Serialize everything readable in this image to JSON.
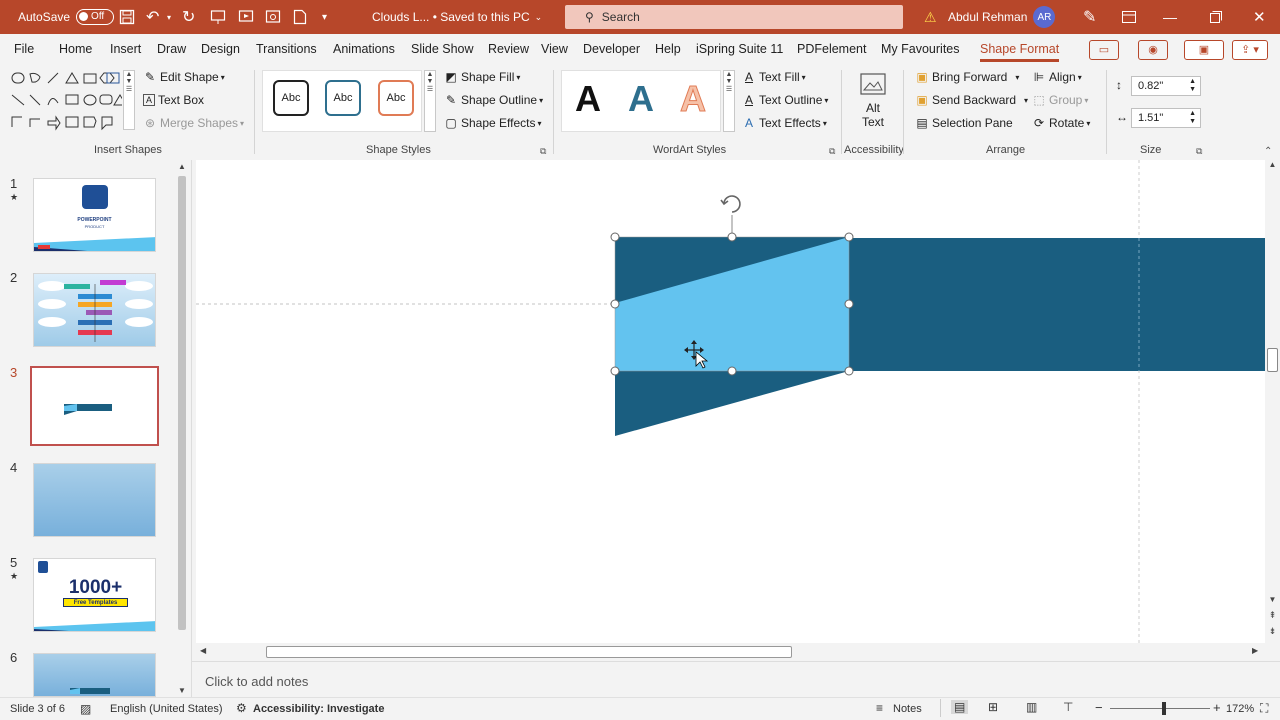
{
  "titlebar": {
    "autosave_label": "AutoSave",
    "autosave_state": "Off",
    "doc_title": "Clouds L... • Saved to this PC",
    "search_placeholder": "Search",
    "user_name": "Abdul Rehman",
    "user_initials": "AR",
    "accent": "#b7472a"
  },
  "tabs": [
    "File",
    "Home",
    "Insert",
    "Draw",
    "Design",
    "Transitions",
    "Animations",
    "Slide Show",
    "Review",
    "View",
    "Developer",
    "Help",
    "iSpring Suite 11",
    "PDFelement",
    "My Favourites",
    "Shape Format"
  ],
  "active_tab": "Shape Format",
  "ribbon": {
    "insert_shapes": {
      "label": "Insert Shapes",
      "edit_shape": "Edit Shape",
      "text_box": "Text Box",
      "merge_shapes": "Merge Shapes"
    },
    "shape_styles": {
      "label": "Shape Styles",
      "abc": "Abc",
      "shape_fill": "Shape Fill",
      "shape_outline": "Shape Outline",
      "shape_effects": "Shape Effects"
    },
    "wordart_styles": {
      "label": "WordArt Styles",
      "letter": "A",
      "text_fill": "Text Fill",
      "text_outline": "Text Outline",
      "text_effects": "Text Effects"
    },
    "accessibility": {
      "label": "Accessibility",
      "alt_text_1": "Alt",
      "alt_text_2": "Text"
    },
    "arrange": {
      "label": "Arrange",
      "bring_forward": "Bring Forward",
      "send_backward": "Send Backward",
      "selection_pane": "Selection Pane",
      "align": "Align",
      "group": "Group",
      "rotate": "Rotate"
    },
    "size": {
      "label": "Size",
      "height": "0.82\"",
      "width": "1.51\""
    }
  },
  "slides": [
    {
      "num": "1",
      "star": "★",
      "text1": "POWERPOINT",
      "text2": "PRODUCT"
    },
    {
      "num": "2",
      "star": ""
    },
    {
      "num": "3",
      "star": ""
    },
    {
      "num": "4",
      "star": ""
    },
    {
      "num": "5",
      "star": "★",
      "text1": "1000+",
      "text2": "Free Templates"
    },
    {
      "num": "6",
      "star": ""
    }
  ],
  "selected_slide": "3",
  "canvas": {
    "dark_color": "#1a5e80",
    "light_color": "#63c3ef"
  },
  "notes_placeholder": "Click to add notes",
  "status": {
    "slide_info": "Slide 3 of 6",
    "language": "English (United States)",
    "accessibility": "Accessibility: Investigate",
    "notes": "Notes",
    "zoom": "172%"
  }
}
